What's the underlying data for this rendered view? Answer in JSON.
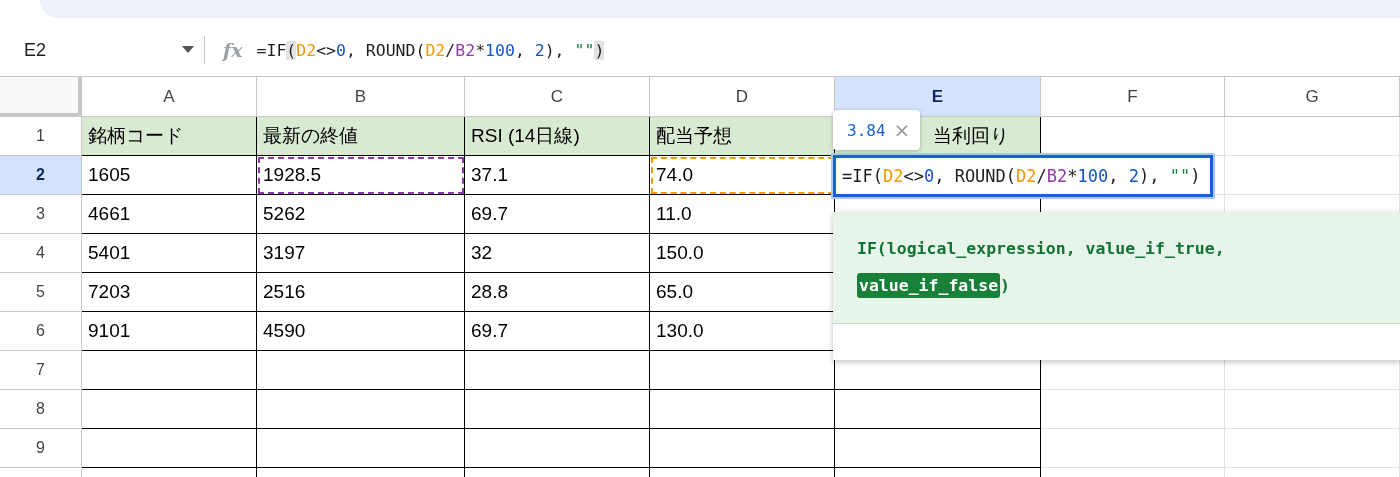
{
  "formula_bar": {
    "name_box": "E2",
    "fx": "fx",
    "tokens": [
      {
        "text": "=IF",
        "kind": "plain"
      },
      {
        "text": "(",
        "kind": "paren",
        "highlighted": true
      },
      {
        "text": "D2",
        "kind": "ref",
        "color": "#f29900"
      },
      {
        "text": "<>",
        "kind": "plain"
      },
      {
        "text": "0",
        "kind": "number"
      },
      {
        "text": ", ROUND(",
        "kind": "plain"
      },
      {
        "text": "D2",
        "kind": "ref",
        "color": "#f29900"
      },
      {
        "text": "/",
        "kind": "plain"
      },
      {
        "text": "B2",
        "kind": "ref",
        "color": "#8e3aa8"
      },
      {
        "text": "*",
        "kind": "plain"
      },
      {
        "text": "100",
        "kind": "number"
      },
      {
        "text": ", ",
        "kind": "plain"
      },
      {
        "text": "2",
        "kind": "number"
      },
      {
        "text": "), ",
        "kind": "plain"
      },
      {
        "text": "\"\"",
        "kind": "string"
      },
      {
        "text": ")",
        "kind": "paren",
        "highlighted": true
      }
    ]
  },
  "columns": [
    {
      "label": "A",
      "selected": false
    },
    {
      "label": "B",
      "selected": false
    },
    {
      "label": "C",
      "selected": false
    },
    {
      "label": "D",
      "selected": false
    },
    {
      "label": "E",
      "selected": true
    },
    {
      "label": "F",
      "selected": false
    },
    {
      "label": "G",
      "selected": false
    }
  ],
  "rows": [
    {
      "label": "1",
      "selected": false,
      "shaded": true,
      "cells": [
        {
          "text": "銘柄コード"
        },
        {
          "text": "最新の終値"
        },
        {
          "text": "RSI (14日線)"
        },
        {
          "text": "配当予想"
        },
        {
          "text": "当利回り"
        }
      ]
    },
    {
      "label": "2",
      "selected": true,
      "shaded": false,
      "cells": [
        {
          "text": "1605"
        },
        {
          "text": "1928.5",
          "color": "#8e3aa8"
        },
        {
          "text": "37.1"
        },
        {
          "text": "74.0",
          "color": "#f29900"
        }
      ]
    },
    {
      "label": "3",
      "selected": false,
      "shaded": false,
      "cells": [
        {
          "text": "4661"
        },
        {
          "text": "5262"
        },
        {
          "text": "69.7"
        },
        {
          "text": "11.0"
        }
      ]
    },
    {
      "label": "4",
      "selected": false,
      "shaded": false,
      "cells": [
        {
          "text": "5401"
        },
        {
          "text": "3197"
        },
        {
          "text": "32"
        },
        {
          "text": "150.0"
        }
      ]
    },
    {
      "label": "5",
      "selected": false,
      "shaded": false,
      "cells": [
        {
          "text": "7203"
        },
        {
          "text": "2516"
        },
        {
          "text": "28.8"
        },
        {
          "text": "65.0"
        }
      ]
    },
    {
      "label": "6",
      "selected": false,
      "shaded": false,
      "cells": [
        {
          "text": "9101"
        },
        {
          "text": "4590"
        },
        {
          "text": "69.7"
        },
        {
          "text": "130.0"
        }
      ]
    },
    {
      "label": "7",
      "selected": false,
      "shaded": false,
      "cells": []
    },
    {
      "label": "8",
      "selected": false,
      "shaded": false,
      "cells": []
    },
    {
      "label": "9",
      "selected": false,
      "shaded": false,
      "cells": []
    },
    {
      "selected": false,
      "shaded": false,
      "cells": []
    }
  ],
  "preview": {
    "value": "3.84",
    "close": "×"
  },
  "editor": {
    "tokens": [
      {
        "text": "=IF(",
        "kind": "plain"
      },
      {
        "text": "D2",
        "kind": "ref",
        "color": "#f29900"
      },
      {
        "text": "<>",
        "kind": "plain"
      },
      {
        "text": "0",
        "kind": "number"
      },
      {
        "text": ", ROUND(",
        "kind": "plain"
      },
      {
        "text": "D2",
        "kind": "ref",
        "color": "#f29900"
      },
      {
        "text": "/",
        "kind": "plain"
      },
      {
        "text": "B2",
        "kind": "ref",
        "color": "#8e3aa8"
      },
      {
        "text": "*",
        "kind": "plain"
      },
      {
        "text": "100",
        "kind": "number"
      },
      {
        "text": ", ",
        "kind": "plain"
      },
      {
        "text": "2",
        "kind": "number"
      },
      {
        "text": "), ",
        "kind": "plain"
      },
      {
        "text": "\"\"",
        "kind": "string"
      },
      {
        "text": ")",
        "kind": "plain"
      }
    ]
  },
  "function_help": {
    "parts": [
      {
        "text": "IF(",
        "active": false
      },
      {
        "text": "logical_expression",
        "active": false
      },
      {
        "text": ", ",
        "active": false
      },
      {
        "text": "value_if_true",
        "active": false
      },
      {
        "text": ", ",
        "active": false
      },
      {
        "text": "value_if_false",
        "active": true
      },
      {
        "text": ")",
        "active": false
      }
    ]
  }
}
